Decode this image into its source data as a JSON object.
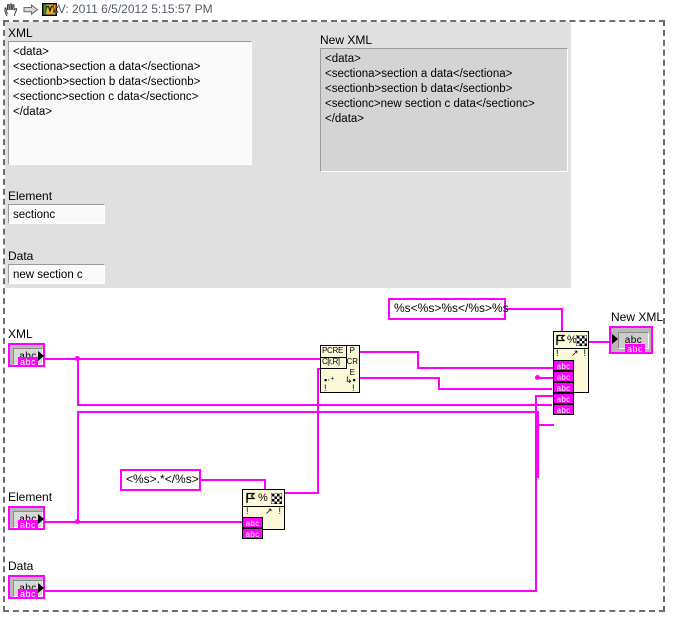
{
  "titlebar": {
    "text": "LV: 2011 6/5/2012 5:15:57 PM",
    "icons": [
      "hand-icon",
      "arrow-icon",
      "labview-icon"
    ]
  },
  "front_panel": {
    "xml_control": {
      "label": "XML",
      "value": "<data>\n<sectiona>section a data</sectiona>\n<sectionb>section b data</sectionb>\n<sectionc>section c data</sectionc>\n</data>"
    },
    "new_xml_indicator": {
      "label": "New XML",
      "value": "<data>\n<sectiona>section a data</sectiona>\n<sectionb>section b data</sectionb>\n<sectionc>new section c data</sectionc>\n</data>"
    },
    "element_control": {
      "label": "Element",
      "value": "sectionc"
    },
    "data_control": {
      "label": "Data",
      "value": "new section c"
    }
  },
  "block_diagram": {
    "terminals": {
      "xml": {
        "label": "XML",
        "type": "abc",
        "tail": "abc"
      },
      "element": {
        "label": "Element",
        "type": "abc",
        "tail": "abc"
      },
      "data": {
        "label": "Data",
        "type": "abc",
        "tail": "abc"
      },
      "new_xml": {
        "label": "New XML",
        "type": "abc",
        "tail": "abc"
      }
    },
    "constants": {
      "format_string": "%s<%s>%s</%s>%s",
      "search_pattern": "<%s>.*</%s>"
    },
    "nodes": {
      "match_regex": {
        "name": "Match Regular Expression",
        "line1": "PCRE",
        "line2": "C[r,R]",
        "out1": "P",
        "out2": "CR",
        "out3": "E"
      },
      "format_small": {
        "name": "Format Into String",
        "glyph": "%",
        "input_pins": [
          "abc",
          "abc"
        ]
      },
      "format_large": {
        "name": "Format Into String",
        "glyph": "%",
        "input_pins": [
          "abc",
          "abc",
          "abc",
          "abc",
          "abc"
        ]
      }
    }
  },
  "colors": {
    "wire_string": "#ff00ff",
    "node_fill": "#fbf9d8",
    "panel_bg": "#e0e0e0",
    "control_bg": "#fafafa",
    "indicator_bg": "#d4d4d4"
  }
}
